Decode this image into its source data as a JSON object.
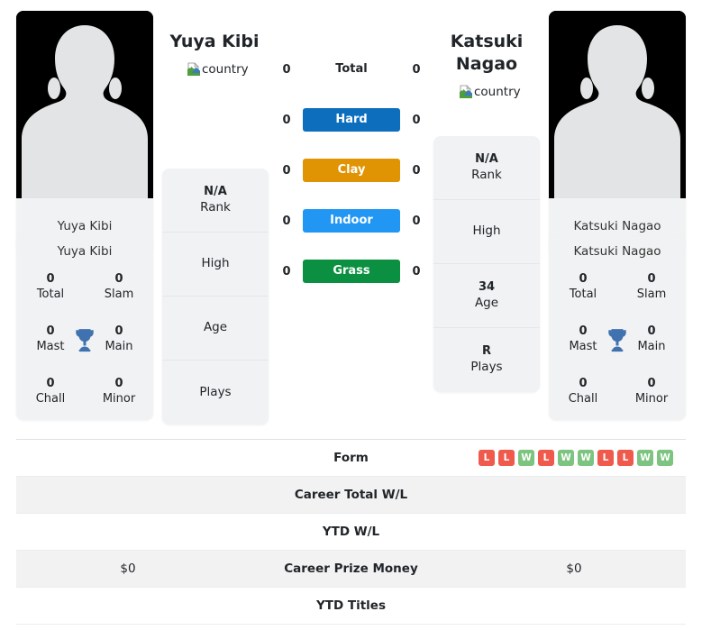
{
  "players": {
    "left": {
      "name": "Yuya Kibi",
      "photo_caption": "Yuya Kibi",
      "country_alt": "country",
      "bio": [
        {
          "value": "N/A",
          "label": "Rank"
        },
        {
          "value": "",
          "label": "High"
        },
        {
          "value": "",
          "label": "Age"
        },
        {
          "value": "",
          "label": "Plays"
        }
      ],
      "titles": [
        {
          "value": "0",
          "label": "Total"
        },
        {
          "value": "0",
          "label": "Slam"
        },
        {
          "value": "0",
          "label": "Mast"
        },
        {
          "value": "0",
          "label": "Main"
        },
        {
          "value": "0",
          "label": "Chall"
        },
        {
          "value": "0",
          "label": "Minor"
        }
      ],
      "surface_counts": [
        "0",
        "0",
        "0",
        "0",
        "0"
      ],
      "career_prize_money": "$0",
      "career_total_wl": "",
      "ytd_wl": "",
      "ytd_titles": ""
    },
    "right": {
      "name": "Katsuki Nagao",
      "photo_caption": "Katsuki Nagao",
      "country_alt": "country",
      "bio": [
        {
          "value": "N/A",
          "label": "Rank"
        },
        {
          "value": "",
          "label": "High"
        },
        {
          "value": "34",
          "label": "Age"
        },
        {
          "value": "R",
          "label": "Plays"
        }
      ],
      "titles": [
        {
          "value": "0",
          "label": "Total"
        },
        {
          "value": "0",
          "label": "Slam"
        },
        {
          "value": "0",
          "label": "Mast"
        },
        {
          "value": "0",
          "label": "Main"
        },
        {
          "value": "0",
          "label": "Chall"
        },
        {
          "value": "0",
          "label": "Minor"
        }
      ],
      "surface_counts": [
        "0",
        "0",
        "0",
        "0",
        "0"
      ],
      "career_prize_money": "$0",
      "career_total_wl": "",
      "ytd_wl": "",
      "ytd_titles": ""
    }
  },
  "surfaces": [
    {
      "label": "Total",
      "color": "transparent",
      "text_color": "#212529"
    },
    {
      "label": "Hard",
      "color": "#0c6ebd",
      "text_color": "#ffffff"
    },
    {
      "label": "Clay",
      "color": "#e09404",
      "text_color": "#ffffff"
    },
    {
      "label": "Indoor",
      "color": "#2196f3",
      "text_color": "#ffffff"
    },
    {
      "label": "Grass",
      "color": "#0a9040",
      "text_color": "#ffffff"
    }
  ],
  "stat_rows": [
    {
      "label": "Form",
      "left": "",
      "right": "",
      "type": "form"
    },
    {
      "label": "Career Total W/L",
      "left": "",
      "right": "",
      "type": "text"
    },
    {
      "label": "YTD W/L",
      "left": "",
      "right": "",
      "type": "text"
    },
    {
      "label": "Career Prize Money",
      "left": "$0",
      "right": "$0",
      "type": "text"
    },
    {
      "label": "YTD Titles",
      "left": "",
      "right": "",
      "type": "text"
    }
  ],
  "form": {
    "results": [
      "L",
      "L",
      "W",
      "L",
      "W",
      "W",
      "L",
      "L",
      "W",
      "W"
    ],
    "win_color": "#7cc47f",
    "loss_color": "#ef5a4c"
  },
  "icons": {
    "trophy": "trophy-icon",
    "broken_image": "broken-image-icon",
    "avatar": "avatar-silhouette-icon"
  },
  "colors": {
    "card_bg": "#f1f2f3",
    "photo_bg": "#000000",
    "stripe": "#f2f2f3",
    "trophy": "#3f72ae"
  }
}
